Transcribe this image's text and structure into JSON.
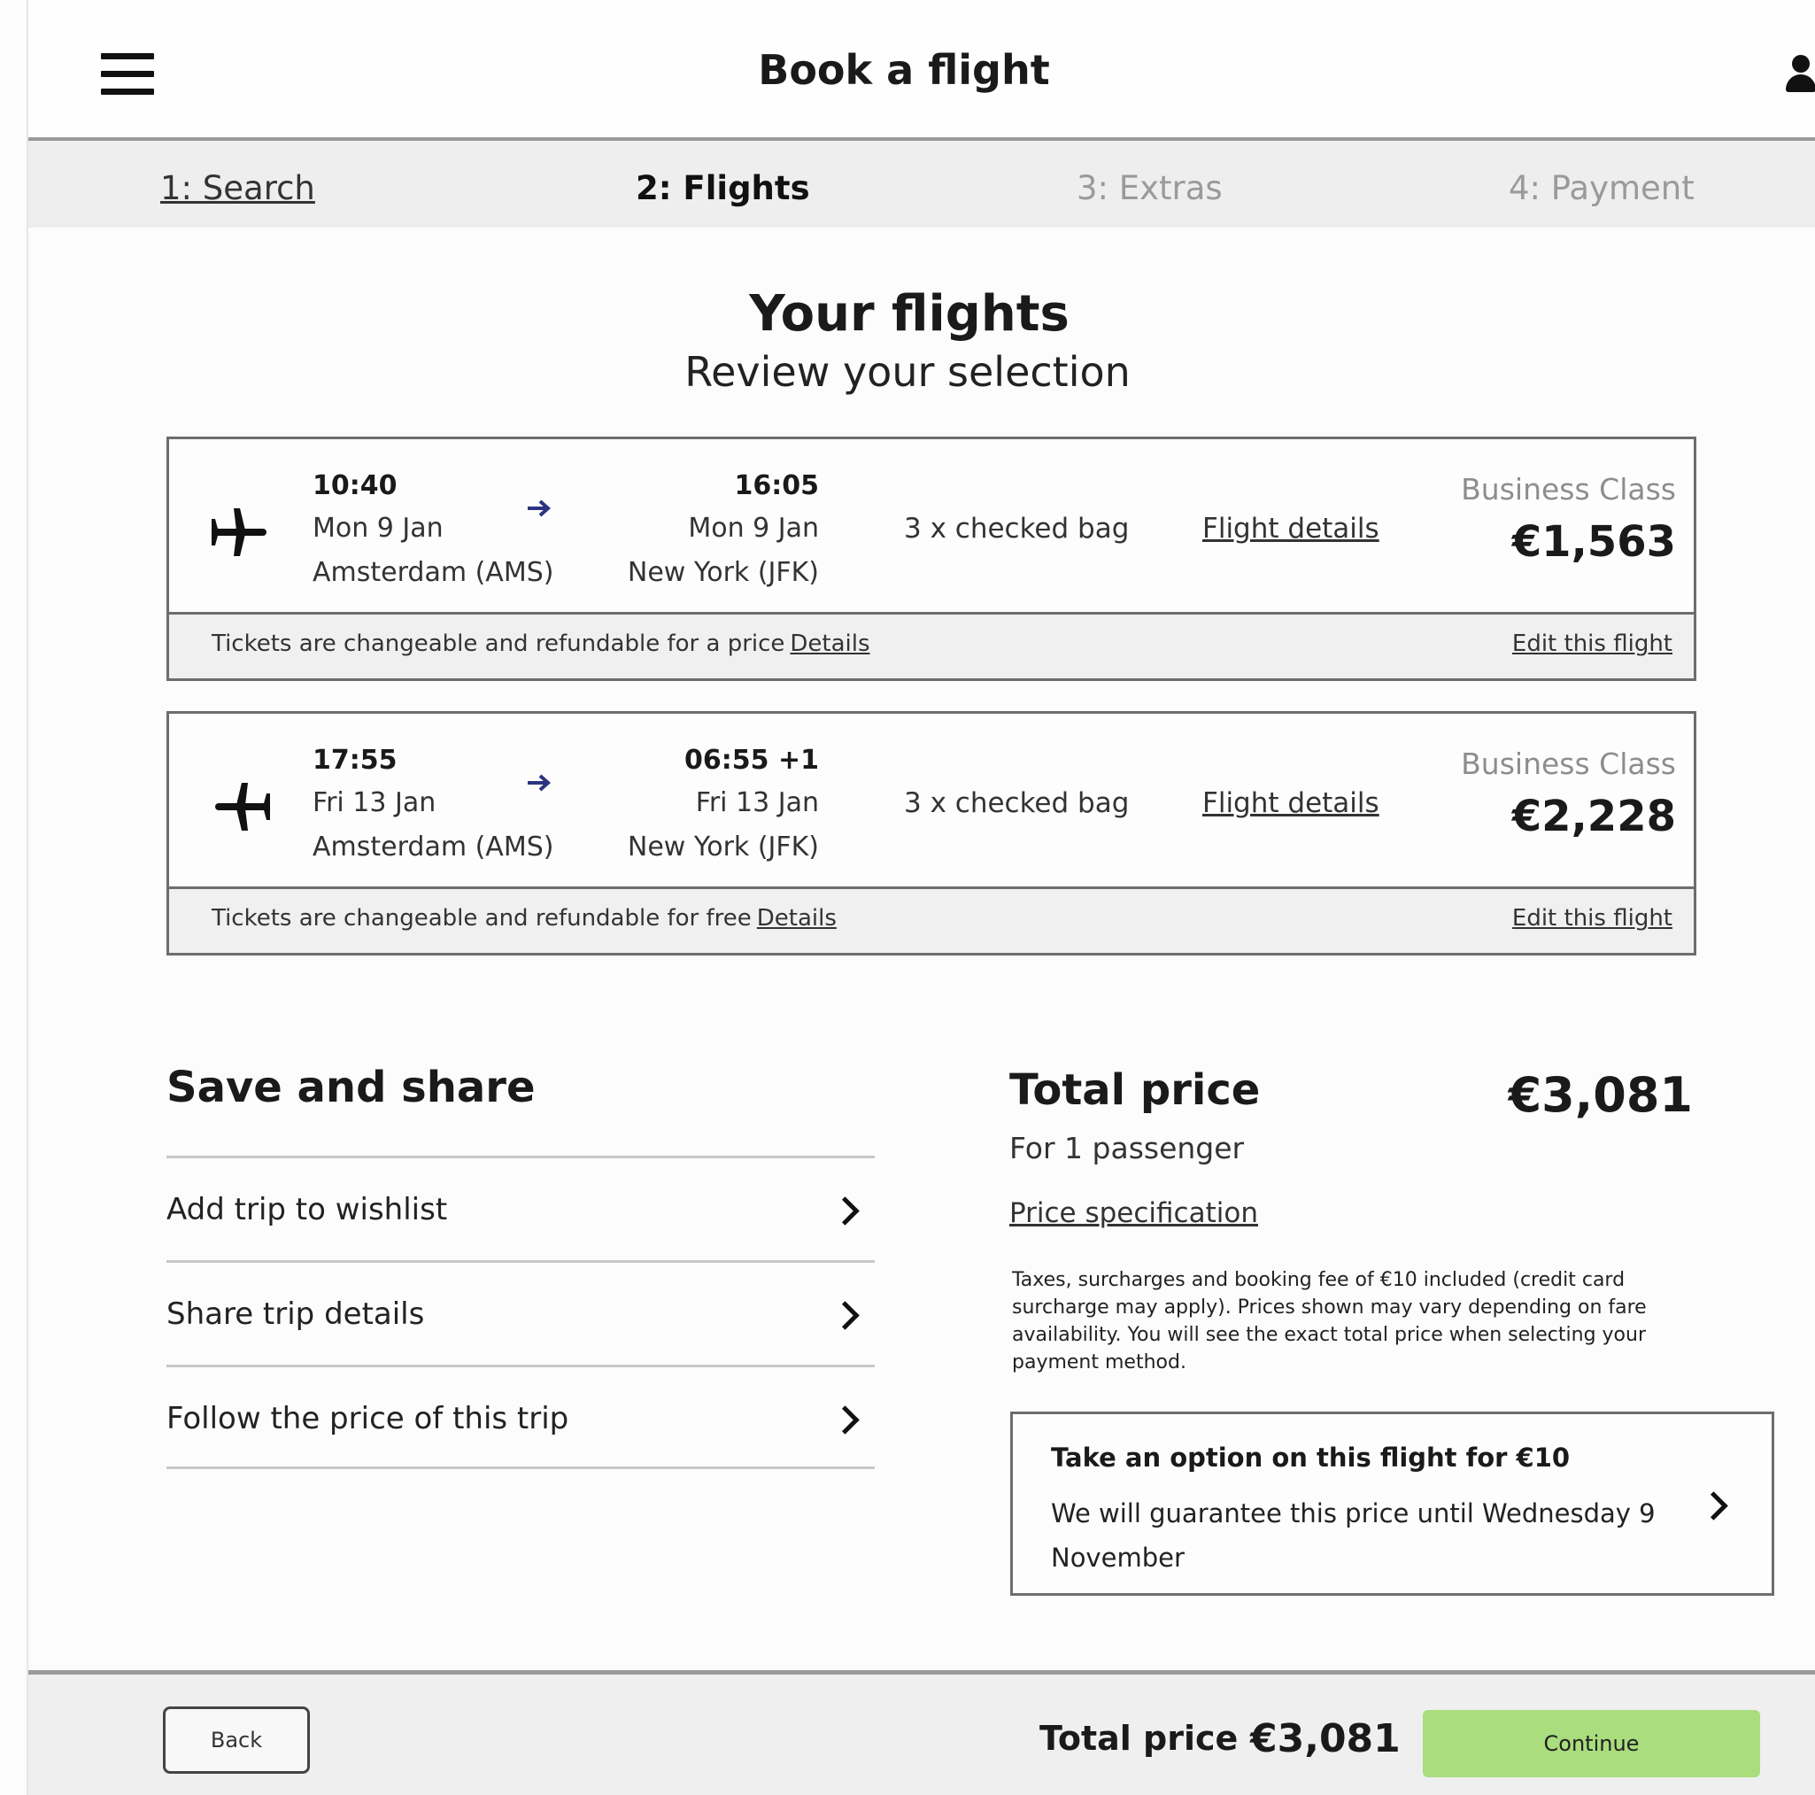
{
  "header": {
    "title": "Book a flight",
    "menu_icon": "hamburger-menu-icon",
    "user_icon": "user-icon"
  },
  "steps": [
    {
      "label": "1: Search",
      "state": "done"
    },
    {
      "label": "2: Flights",
      "state": "current"
    },
    {
      "label": "3: Extras",
      "state": "upcoming"
    },
    {
      "label": "4: Payment",
      "state": "upcoming"
    }
  ],
  "page": {
    "title": "Your flights",
    "subtitle": "Review your selection"
  },
  "flights": [
    {
      "direction": "outbound",
      "icon": "plane-right-icon",
      "dep_time": "10:40",
      "dep_date": "Mon 9 Jan",
      "dep_city": "Amsterdam (AMS)",
      "arr_time": "16:05",
      "arr_date": "Mon 9 Jan",
      "arr_city": "New York (JFK)",
      "bags": "3 x checked bag",
      "details_link": "Flight details",
      "cabin_class": "Business Class",
      "price": "€1,563",
      "ticket_note": "Tickets are changeable and refundable for a price",
      "ticket_link": "Details",
      "edit_link": "Edit this flight"
    },
    {
      "direction": "return",
      "icon": "plane-left-icon",
      "dep_time": "17:55",
      "dep_date": "Fri 13 Jan",
      "dep_city": "Amsterdam (AMS)",
      "arr_time": "06:55 +1",
      "arr_date": "Fri 13 Jan",
      "arr_city": "New York (JFK)",
      "bags": "3 x checked bag",
      "details_link": "Flight details",
      "cabin_class": "Business Class",
      "price": "€2,228",
      "ticket_note": "Tickets are changeable and refundable for free",
      "ticket_link": "Details",
      "edit_link": "Edit this flight"
    }
  ],
  "save_share": {
    "title": "Save and share",
    "items": [
      {
        "label": "Add trip to wishlist"
      },
      {
        "label": "Share trip details"
      },
      {
        "label": "Follow the price of this trip"
      }
    ]
  },
  "total": {
    "title": "Total price",
    "value": "€3,081",
    "passengers": "For 1 passenger",
    "spec_link": "Price specification",
    "note": "Taxes, surcharges and booking fee of €10 included (credit card surcharge may apply). Prices shown may vary depending on fare availability. You will see the exact total price when selecting your payment method."
  },
  "option": {
    "title": "Take an option on this flight for €10",
    "description": "We will guarantee this price until Wednesday 9 November"
  },
  "bottom_bar": {
    "back_label": "Back",
    "total_label": "Total price",
    "total_value": "€3,081",
    "continue_label": "Continue",
    "continue_color": "#a9dd7e"
  }
}
